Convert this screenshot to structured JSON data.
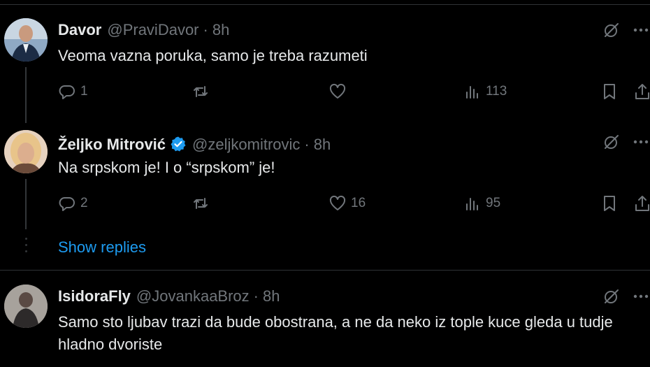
{
  "tweets": [
    {
      "name": "Davor",
      "handle": "@PraviDavor",
      "separator": "·",
      "time": "8h",
      "verified": false,
      "text": "Veoma vazna poruka, samo je treba razumeti",
      "replies": "1",
      "retweets": "",
      "likes": "",
      "views": "113"
    },
    {
      "name": "Željko Mitrović",
      "handle": "@zeljkomitrovic",
      "separator": "·",
      "time": "8h",
      "verified": true,
      "text": "Na srpskom je! I o “srpskom” je!",
      "replies": "2",
      "retweets": "",
      "likes": "16",
      "views": "95"
    },
    {
      "name": "IsidoraFly",
      "handle": "@JovankaaBroz",
      "separator": "·",
      "time": "8h",
      "verified": false,
      "text": "Samo sto ljubav trazi da bude obostrana, a ne da neko iz tople kuce gleda u tudje hladno dvoriste"
    }
  ],
  "show_replies_label": "Show replies",
  "icons": {
    "reply": "reply-icon",
    "retweet": "retweet-icon",
    "like": "heart-icon",
    "views": "views-icon",
    "bookmark": "bookmark-icon",
    "share": "share-icon",
    "grok": "grok-icon",
    "more": "more-icon",
    "verified": "verified-badge-icon"
  },
  "colors": {
    "background": "#000000",
    "text": "#e7e9ea",
    "muted": "#71767b",
    "link": "#1d9bf0",
    "verified": "#1d9bf0",
    "divider": "#2f3336"
  }
}
